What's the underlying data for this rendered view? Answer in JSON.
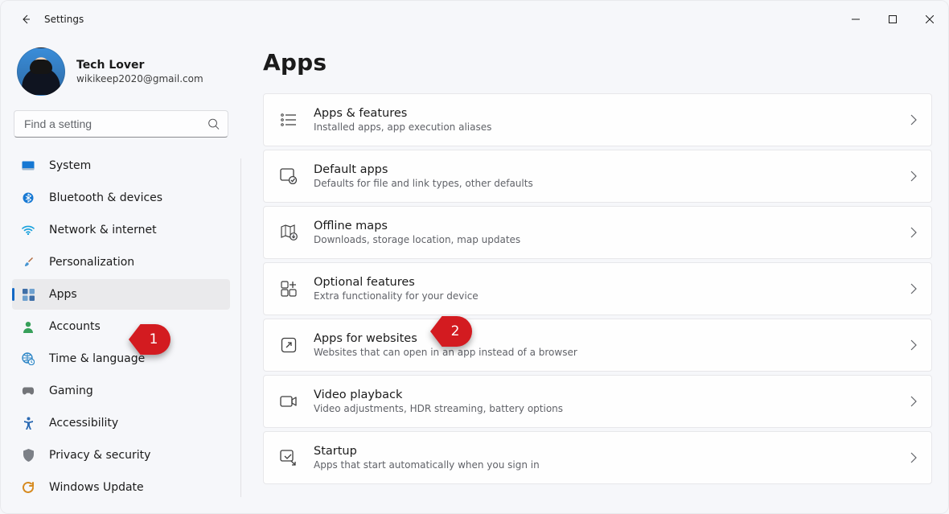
{
  "window": {
    "title": "Settings"
  },
  "profile": {
    "name": "Tech Lover",
    "email": "wikikeep2020@gmail.com"
  },
  "search": {
    "placeholder": "Find a setting"
  },
  "sidebar": {
    "items": [
      {
        "id": "system",
        "label": "System",
        "icon": "system-icon",
        "color": "#1678d3"
      },
      {
        "id": "bluetooth",
        "label": "Bluetooth & devices",
        "icon": "bluetooth-icon",
        "color": "#1678d3"
      },
      {
        "id": "network",
        "label": "Network & internet",
        "icon": "wifi-icon",
        "color": "#1aa1dc"
      },
      {
        "id": "personalization",
        "label": "Personalization",
        "icon": "brush-icon",
        "color": "#b06a3e"
      },
      {
        "id": "apps",
        "label": "Apps",
        "icon": "apps-icon",
        "color": "#3f6fa8",
        "selected": true
      },
      {
        "id": "accounts",
        "label": "Accounts",
        "icon": "person-icon",
        "color": "#37a05a"
      },
      {
        "id": "time",
        "label": "Time & language",
        "icon": "globe-clock-icon",
        "color": "#2e86c6"
      },
      {
        "id": "gaming",
        "label": "Gaming",
        "icon": "controller-icon",
        "color": "#737579"
      },
      {
        "id": "accessibility",
        "label": "Accessibility",
        "icon": "accessibility-icon",
        "color": "#2d6bb3"
      },
      {
        "id": "privacy",
        "label": "Privacy & security",
        "icon": "shield-icon",
        "color": "#7c8087"
      },
      {
        "id": "update",
        "label": "Windows Update",
        "icon": "update-icon",
        "color": "#d68a1f"
      }
    ]
  },
  "page": {
    "title": "Apps",
    "cards": [
      {
        "id": "apps-features",
        "title": "Apps & features",
        "sub": "Installed apps, app execution aliases",
        "icon": "list-icon"
      },
      {
        "id": "default-apps",
        "title": "Default apps",
        "sub": "Defaults for file and link types, other defaults",
        "icon": "default-apps-icon"
      },
      {
        "id": "offline-maps",
        "title": "Offline maps",
        "sub": "Downloads, storage location, map updates",
        "icon": "map-download-icon"
      },
      {
        "id": "optional-features",
        "title": "Optional features",
        "sub": "Extra functionality for your device",
        "icon": "features-plus-icon"
      },
      {
        "id": "apps-for-websites",
        "title": "Apps for websites",
        "sub": "Websites that can open in an app instead of a browser",
        "icon": "open-external-icon"
      },
      {
        "id": "video-playback",
        "title": "Video playback",
        "sub": "Video adjustments, HDR streaming, battery options",
        "icon": "video-icon"
      },
      {
        "id": "startup",
        "title": "Startup",
        "sub": "Apps that start automatically when you sign in",
        "icon": "startup-icon"
      }
    ]
  },
  "annotations": {
    "m1": "1",
    "m2": "2"
  }
}
